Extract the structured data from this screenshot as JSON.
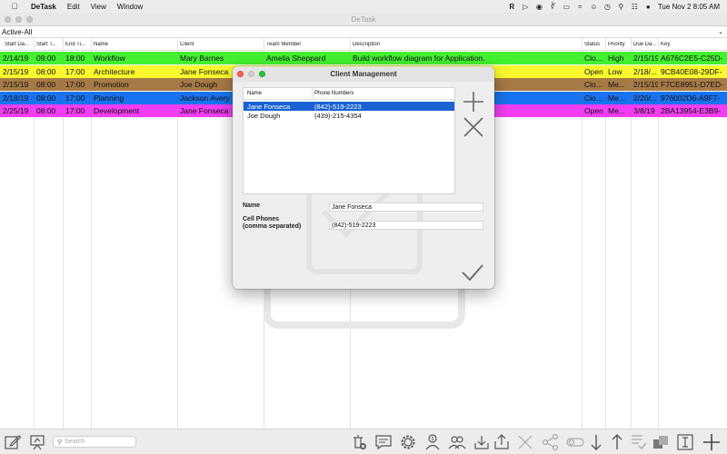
{
  "menubar": {
    "app_name": "DeTask",
    "menus": [
      "Edit",
      "View",
      "Window"
    ],
    "clock": "Tue Nov 2  8:05 AM"
  },
  "window": {
    "title": "DeTask"
  },
  "filter": {
    "value": "Active-All"
  },
  "table": {
    "columns": [
      "Start Da...",
      "Start T...",
      "End Ti...",
      "Name",
      "Client",
      "Team Member",
      "Description",
      "Status",
      "Priority",
      "Due Da...",
      "Key"
    ],
    "rows": [
      {
        "color": "#42f02f",
        "cells": [
          "2/14/19",
          "09:00",
          "18:00",
          "Workflow",
          "Mary Barnes",
          "Amelia Sheppard",
          "Build workflow diagram for Application.",
          "Clo...",
          "High",
          "2/15/19",
          "A676C2E5-C25D-"
        ]
      },
      {
        "color": "#fbf92d",
        "cells": [
          "2/15/19",
          "08:00",
          "17:00",
          "Architecture",
          "Jane Fonseca",
          "",
          "",
          "Open",
          "Low",
          "2/18/...",
          "9CB40E08-29DF-"
        ]
      },
      {
        "color": "#a67a47",
        "cells": [
          "2/15/19",
          "08:00",
          "17:00",
          "Promotion",
          "Joe Dough",
          "",
          "",
          "Clo...",
          "Me...",
          "2/15/19",
          "F7CE8951-D7ED-"
        ]
      },
      {
        "color": "#1a73ee",
        "cells": [
          "2/18/19",
          "08:00",
          "17:00",
          "Planning",
          "Jackson Avery",
          "",
          "",
          "Clo...",
          "Me...",
          "2/20/...",
          "976002D6-A9F7-"
        ]
      },
      {
        "color": "#f23ef2",
        "cells": [
          "2/25/19",
          "08:00",
          "17:00",
          "Development",
          "Jane Fonseca",
          "",
          "",
          "Open",
          "Me...",
          "3/8/19",
          "2BA13954-E3B9-"
        ]
      }
    ]
  },
  "toolbar": {
    "search_placeholder": "Search"
  },
  "dialog": {
    "title": "Client Management",
    "list_headers": [
      "Name",
      "Phone Numbers"
    ],
    "clients": [
      {
        "name": "Jane Fonseca",
        "phone": "(842)-519-2223",
        "selected": true
      },
      {
        "name": "Joe Dough",
        "phone": "(439)-215-4354",
        "selected": false
      }
    ],
    "name_label": "Name",
    "name_value": "Jane Fonseca",
    "phones_label_1": "Cell Phones",
    "phones_label_2": "(comma separated)",
    "phones_value": "(842)-519-2223"
  }
}
